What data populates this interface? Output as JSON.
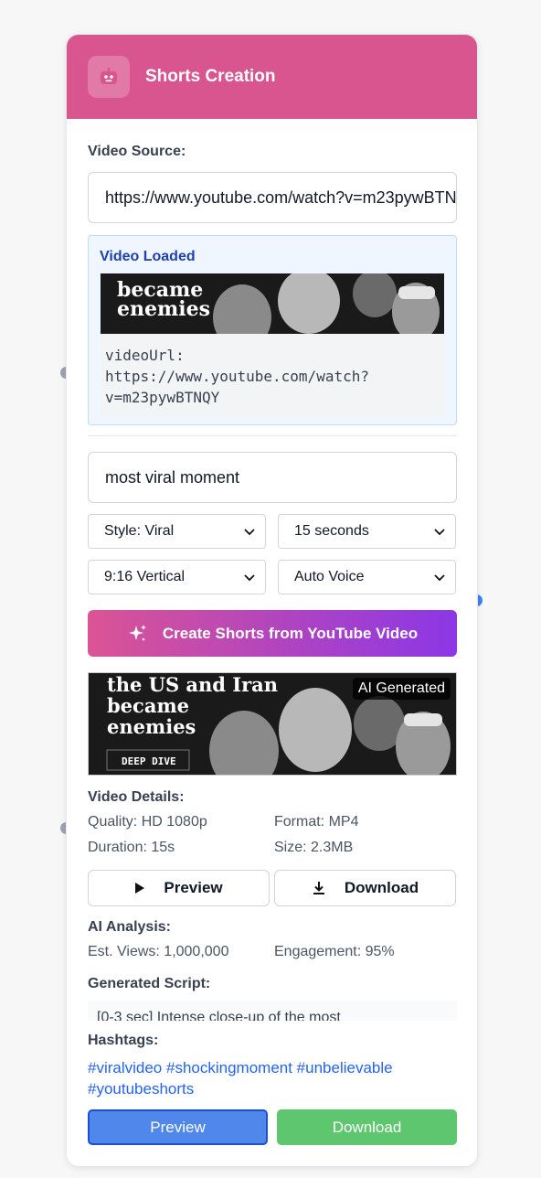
{
  "header": {
    "title": "Shorts Creation",
    "icon": "robot-icon"
  },
  "source": {
    "label": "Video Source:",
    "url_value": "https://www.youtube.com/watch?v=m23pywBTNQY",
    "loaded_title": "Video Loaded",
    "thumbnail_text": [
      "became",
      "enemies"
    ],
    "code_text": "videoUrl:\nhttps://www.youtube.com/watch?\nv=m23pywBTNQY"
  },
  "prompt": {
    "value": "most viral moment"
  },
  "options": {
    "style": "Style: Viral",
    "duration": "15 seconds",
    "aspect": "9:16 Vertical",
    "voice": "Auto Voice"
  },
  "create_button": "Create Shorts from YouTube Video",
  "result": {
    "thumbnail_text": [
      "the US and Iran",
      "became",
      "enemies"
    ],
    "thumbnail_caption": "DEEP DIVE",
    "badge": "AI Generated",
    "details_label": "Video Details:",
    "quality": "Quality: HD 1080p",
    "format": "Format: MP4",
    "duration": "Duration: 15s",
    "size": "Size: 2.3MB",
    "preview_label": "Preview",
    "download_label": "Download"
  },
  "analysis": {
    "label": "AI Analysis:",
    "views": "Est. Views: 1,000,000",
    "engagement": "Engagement: 95%"
  },
  "script": {
    "label": "Generated Script:",
    "text": "[0-3 sec] Intense close-up of the most"
  },
  "hashtags": {
    "label": "Hashtags:",
    "line1": "#viralvideo #shockingmoment #unbelievable",
    "line2": "#youtubeshorts"
  },
  "footer": {
    "preview": "Preview",
    "download": "Download"
  },
  "colors": {
    "header": "#d9558f",
    "gradient_start": "#db5494",
    "gradient_end": "#8b37e6",
    "preview": "#4f87ea",
    "download": "#5ec66f",
    "hashtag": "#2563eb"
  }
}
